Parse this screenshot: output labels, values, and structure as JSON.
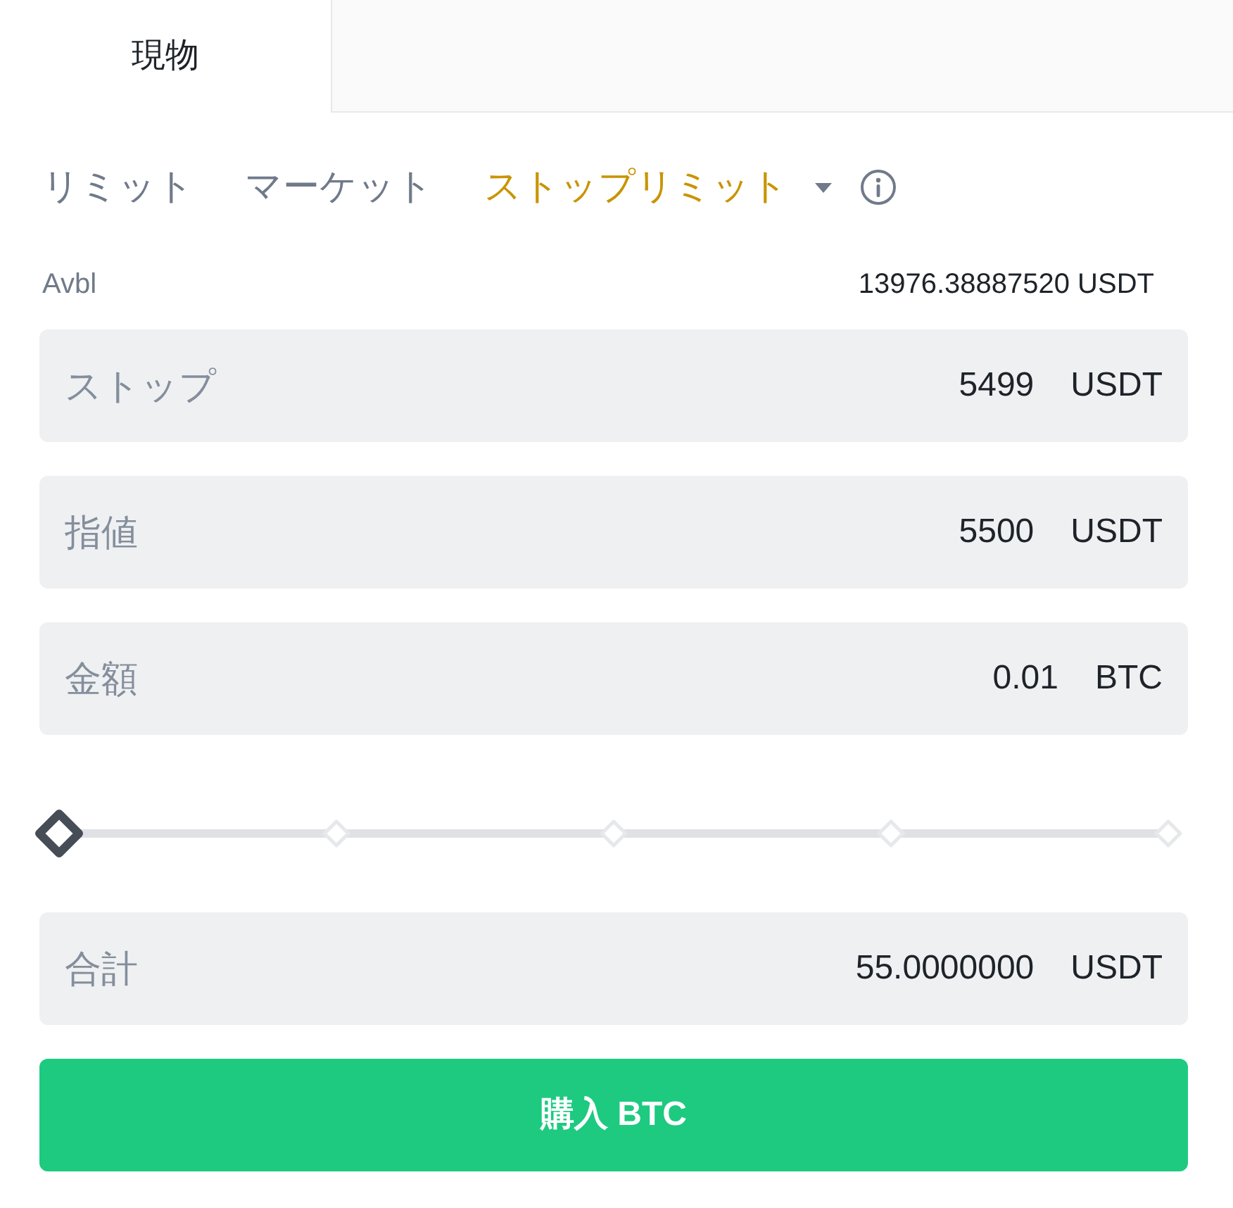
{
  "tabs": [
    {
      "label": "現物",
      "selected": true
    }
  ],
  "order_types": [
    {
      "label": "リミット",
      "selected": false
    },
    {
      "label": "マーケット",
      "selected": false
    },
    {
      "label": "ストップリミット",
      "selected": true
    }
  ],
  "available": {
    "label": "Avbl",
    "value": "13976.38887520 USDT"
  },
  "fields": [
    {
      "label": "ストップ",
      "value": "5499",
      "unit": "USDT"
    },
    {
      "label": "指値",
      "value": "5500",
      "unit": "USDT"
    },
    {
      "label": "金額",
      "value": "0.01",
      "unit": "BTC"
    }
  ],
  "slider": {
    "level": 0
  },
  "total": {
    "label": "合計",
    "value": "55.0000000",
    "unit": "USDT"
  },
  "submit_button": "購入 BTC"
}
